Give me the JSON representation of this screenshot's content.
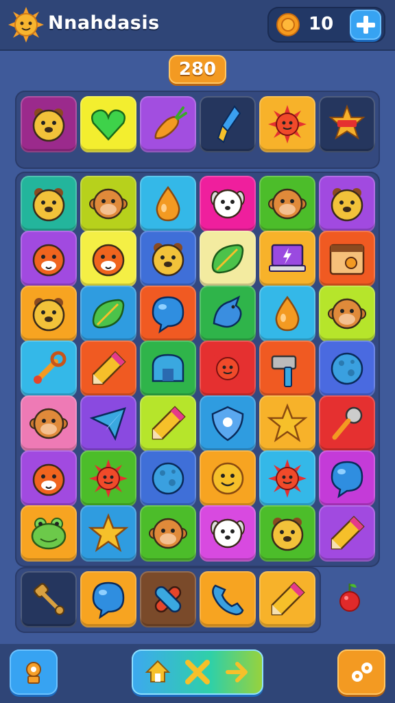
{
  "header": {
    "title": "Nnahdasis",
    "sun_icon": "sun-mascot-icon",
    "coin_icon": "coin-icon",
    "coins": "10",
    "add_button_icon": "plus-icon"
  },
  "score": "280",
  "colors": {
    "background": "#3f5a9a",
    "topbar": "#2f4577",
    "accent_blue": "#37a3f2",
    "score_orange": "#f39a22"
  },
  "top_row": [
    {
      "icon": "bear-icon",
      "bg": "#9b2a8c"
    },
    {
      "icon": "heart-icon",
      "bg": "#f3ee2f"
    },
    {
      "icon": "carrot-icon",
      "bg": "#a24ee0"
    },
    {
      "icon": "rocket-icon",
      "bg": "#25365e"
    },
    {
      "icon": "sun-icon",
      "bg": "#f7b22a"
    },
    {
      "icon": "badge-star-icon",
      "bg": "#25365e"
    }
  ],
  "grid": [
    [
      {
        "icon": "bear-icon",
        "bg": "#23b59c"
      },
      {
        "icon": "monkey-icon",
        "bg": "#b7d11c"
      },
      {
        "icon": "drop-icon",
        "bg": "#34b8e8"
      },
      {
        "icon": "dog-icon",
        "bg": "#ef1f9d"
      },
      {
        "icon": "monkey-icon",
        "bg": "#4cbd2a"
      },
      {
        "icon": "bear-icon",
        "bg": "#a14ae0"
      }
    ],
    [
      {
        "icon": "tiger-icon",
        "bg": "#a14ae0"
      },
      {
        "icon": "tiger-icon",
        "bg": "#f4ef45"
      },
      {
        "icon": "bear-icon",
        "bg": "#3f6fd8"
      },
      {
        "icon": "leaf-icon",
        "bg": "#f3eba0"
      },
      {
        "icon": "laptop-icon",
        "bg": "#f7b22a"
      },
      {
        "icon": "calendar-icon",
        "bg": "#f05a22"
      }
    ],
    [
      {
        "icon": "bear-icon",
        "bg": "#f7a421"
      },
      {
        "icon": "leaf-icon",
        "bg": "#2f9ce0"
      },
      {
        "icon": "chat-bubble-icon",
        "bg": "#f05a22"
      },
      {
        "icon": "bird-icon",
        "bg": "#2fb44a"
      },
      {
        "icon": "drop-icon",
        "bg": "#34b8e8"
      },
      {
        "icon": "monkey-icon",
        "bg": "#b6e52b"
      }
    ],
    [
      {
        "icon": "wrench-icon",
        "bg": "#34b8e8"
      },
      {
        "icon": "pencil-icon",
        "bg": "#f05a22"
      },
      {
        "icon": "house-icon",
        "bg": "#2fb44a"
      },
      {
        "icon": "sun-icon",
        "bg": "#e53030"
      },
      {
        "icon": "hammer-icon",
        "bg": "#f05a22"
      },
      {
        "icon": "planet-icon",
        "bg": "#4a6ae0"
      }
    ],
    [
      {
        "icon": "monkey-icon",
        "bg": "#ee7ab5"
      },
      {
        "icon": "plane-icon",
        "bg": "#8a4ae0"
      },
      {
        "icon": "pencil-icon",
        "bg": "#b6e52b"
      },
      {
        "icon": "shield-icon",
        "bg": "#2f9ce0"
      },
      {
        "icon": "star-icon",
        "bg": "#f7b22a"
      },
      {
        "icon": "microphone-icon",
        "bg": "#e53030"
      }
    ],
    [
      {
        "icon": "tiger-icon",
        "bg": "#a14ae0"
      },
      {
        "icon": "sun-icon",
        "bg": "#4cbd2a"
      },
      {
        "icon": "planet-icon",
        "bg": "#3f6fd8"
      },
      {
        "icon": "smiley-icon",
        "bg": "#f7a421"
      },
      {
        "icon": "sun-icon",
        "bg": "#34b8e8"
      },
      {
        "icon": "chat-bubble-icon",
        "bg": "#c43bd8"
      }
    ],
    [
      {
        "icon": "frog-icon",
        "bg": "#f7a421"
      },
      {
        "icon": "star-icon",
        "bg": "#2f9ce0"
      },
      {
        "icon": "monkey-icon",
        "bg": "#4cbd2a"
      },
      {
        "icon": "dog-icon",
        "bg": "#d84ae0"
      },
      {
        "icon": "bear-icon",
        "bg": "#4cbd2a"
      },
      {
        "icon": "pencil-icon",
        "bg": "#a14ae0"
      }
    ]
  ],
  "bottom_row": [
    {
      "icon": "mallet-icon",
      "bg": "#25365e"
    },
    {
      "icon": "chat-bubble-icon",
      "bg": "#f7a421"
    },
    {
      "icon": "bandage-icon",
      "bg": "#7a4a2a"
    },
    {
      "icon": "phone-icon",
      "bg": "#f7a421"
    },
    {
      "icon": "pencil-icon",
      "bg": "#f7b22a"
    }
  ],
  "loose_item": "cherry-icon",
  "bottom_bar": {
    "left_button_icon": "trophy-icon",
    "center_icons": [
      "home-icon",
      "shuffle-icon",
      "arrow-icon"
    ],
    "right_button_icon": "settings-icon"
  }
}
